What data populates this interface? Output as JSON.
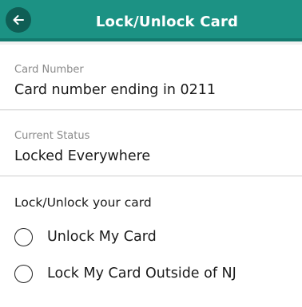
{
  "header": {
    "title": "Lock/Unlock Card",
    "back_icon": "arrow-left-icon",
    "color": "#1c9284"
  },
  "card_number": {
    "label": "Card Number",
    "value": "Card number ending in 0211"
  },
  "current_status": {
    "label": "Current Status",
    "value": "Locked Everywhere"
  },
  "lock_options": {
    "heading": "Lock/Unlock your card",
    "options": [
      {
        "label": "Unlock My Card",
        "selected": false
      },
      {
        "label": "Lock My Card Outside of NJ",
        "selected": false
      }
    ]
  }
}
